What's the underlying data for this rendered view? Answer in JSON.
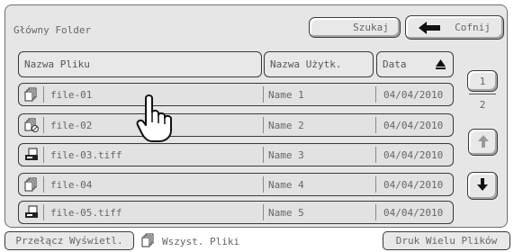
{
  "header": {
    "folder_title": "Główny Folder",
    "search_label": "Szukaj",
    "back_label": "Cofnij"
  },
  "columns": {
    "file_name": "Nazwa Pliku",
    "user_name": "Nazwa Użytk.",
    "date": "Data"
  },
  "sort": {
    "column": "date",
    "direction": "ascending",
    "icon": "triangle-up-icon"
  },
  "files": [
    {
      "name": "file-01",
      "user": "Name 1",
      "date": "04/04/2010",
      "icon": "file-stack-icon"
    },
    {
      "name": "file-02",
      "user": "Name 2",
      "date": "04/04/2010",
      "icon": "file-stack-no-icon"
    },
    {
      "name": "file-03.tiff",
      "user": "Name 3",
      "date": "04/04/2010",
      "icon": "scan-document-icon"
    },
    {
      "name": "file-04",
      "user": "Name 4",
      "date": "04/04/2010",
      "icon": "file-stack-icon"
    },
    {
      "name": "file-05.tiff",
      "user": "Name 5",
      "date": "04/04/2010",
      "icon": "scan-document-icon"
    }
  ],
  "pager": {
    "current_page": "1",
    "total_pages": "2"
  },
  "footer": {
    "switch_view_label": "Przełącz Wyświetl.",
    "all_files_label": "Wszyst. Pliki",
    "batch_print_label": "Druk Wielu Plików"
  },
  "colors": {
    "panel_bg": "#e6e6e6",
    "button_bg": "#e8e8e8",
    "border": "#3a3a3a",
    "text": "#666666"
  }
}
